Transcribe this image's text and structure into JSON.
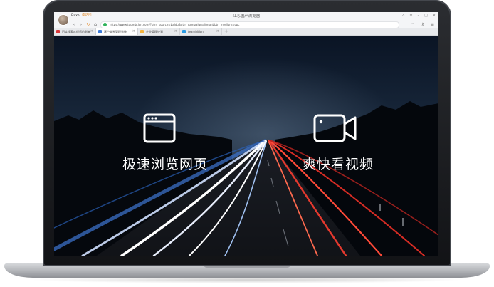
{
  "browser": {
    "window_title": "红芯国产浏览器",
    "user_name": "David",
    "user_badge": "电话团",
    "url": "https://www.toumbtion.com/?utm_source=baidu&utm_campaign=itmanbbtn_medium=cpc",
    "tabs": [
      {
        "label": "百度搜索欢迎您的到来",
        "active": false,
        "favicon_color": "#d9383a"
      },
      {
        "label": "客户关系管理系统",
        "active": true,
        "favicon_color": "#3d7bd8"
      },
      {
        "label": "企业管理计划",
        "active": false,
        "favicon_color": "#f3b33d"
      },
      {
        "label": "teambition",
        "active": false,
        "favicon_color": "#2a9be4"
      }
    ]
  },
  "hero": {
    "feature_browse": "极速浏览网页",
    "feature_video": "爽快看视频",
    "browse_icon": "browser-window-icon",
    "video_icon": "video-camera-icon"
  },
  "colors": {
    "sky": "#0b1220",
    "light_trail_white": "#e8eefc",
    "light_trail_blue": "#4f8fe0",
    "light_trail_red": "#e4392e"
  }
}
